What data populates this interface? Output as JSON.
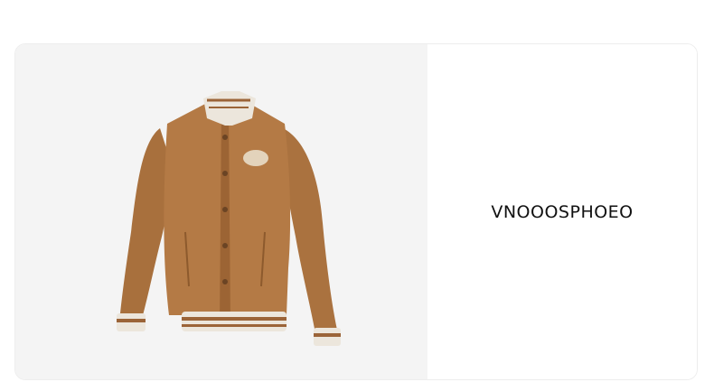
{
  "product": {
    "code": "VNOOOSPHOEO",
    "image": {
      "subject": "jacket",
      "colors": {
        "body": "#b47a45",
        "shadow": "#8d5a2d",
        "rib_cream": "#ece6dc",
        "rib_stripe": "#9b6438"
      }
    }
  },
  "colors": {
    "image_background": "#f4f4f4",
    "card_background": "#ffffff",
    "text": "#111111"
  }
}
